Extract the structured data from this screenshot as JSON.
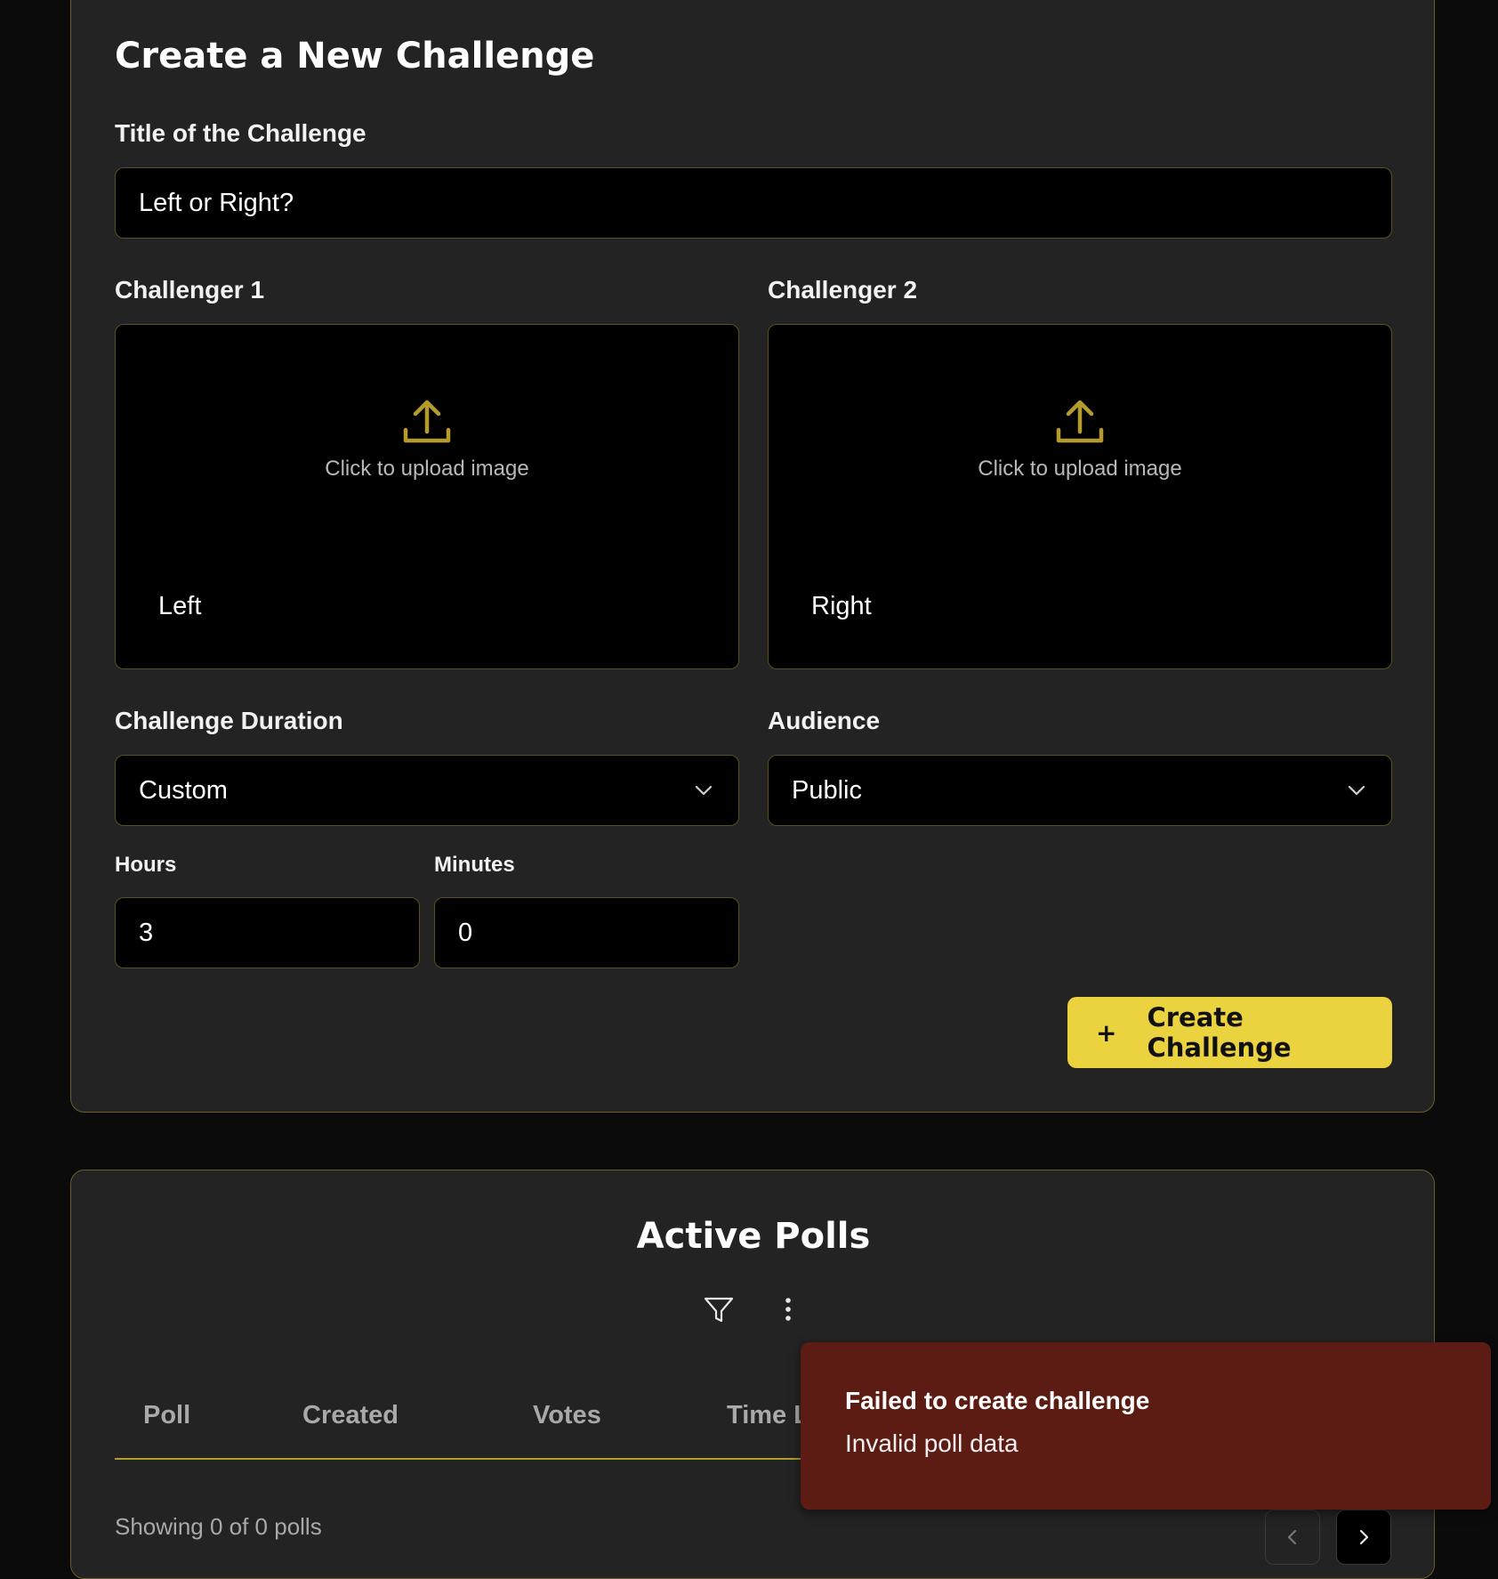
{
  "create_form": {
    "heading": "Create a New Challenge",
    "title_label": "Title of the Challenge",
    "title_value": "Left or Right?",
    "challenger1": {
      "label": "Challenger 1",
      "upload_text": "Click to upload image",
      "name": "Left"
    },
    "challenger2": {
      "label": "Challenger 2",
      "upload_text": "Click to upload image",
      "name": "Right"
    },
    "duration_label": "Challenge Duration",
    "duration_value": "Custom",
    "audience_label": "Audience",
    "audience_value": "Public",
    "hours_label": "Hours",
    "hours_value": "3",
    "minutes_label": "Minutes",
    "minutes_value": "0",
    "submit_label": "Create Challenge",
    "submit_icon": "+"
  },
  "polls": {
    "heading": "Active Polls",
    "columns": [
      "Poll",
      "Created",
      "Votes",
      "Time L"
    ],
    "showing_text": "Showing 0 of 0 polls"
  },
  "toast": {
    "title": "Failed to create challenge",
    "description": "Invalid poll data"
  },
  "colors": {
    "accent": "#ead33f",
    "card_bg": "#232323",
    "toast_bg": "#5c1c14",
    "border": "#6b5d26"
  }
}
